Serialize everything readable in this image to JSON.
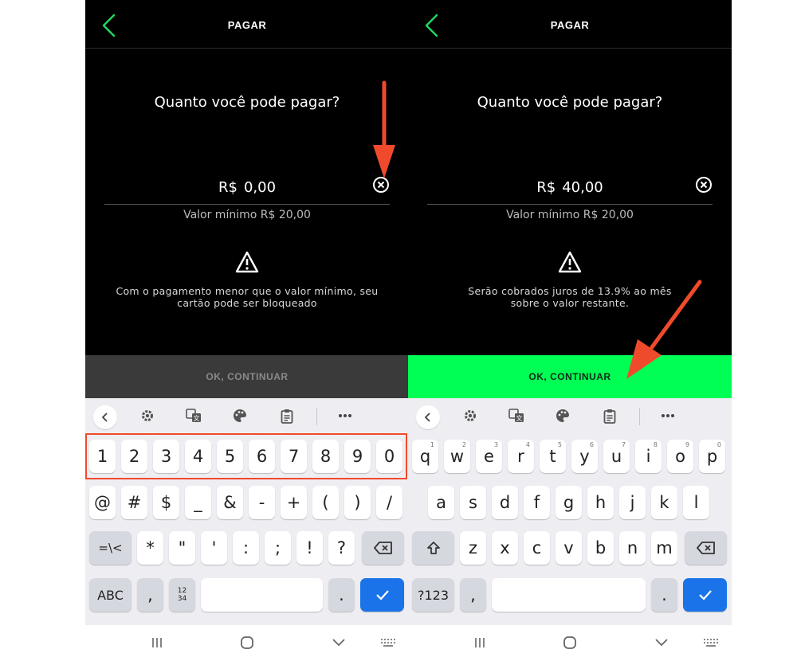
{
  "screens": [
    {
      "id": "left",
      "title": "PAGAR",
      "question": "Quanto você pode pagar?",
      "currency": "R$",
      "amount": "0,00",
      "minimum": "Valor mínimo R$ 20,00",
      "warning_lines": [
        "Com o pagamento menor que o valor mínimo, seu",
        "cartão pode ser bloqueado"
      ],
      "cta_label": "OK, CONTINUAR",
      "cta_state": "disabled"
    },
    {
      "id": "right",
      "title": "PAGAR",
      "question": "Quanto você pode pagar?",
      "currency": "R$",
      "amount": "40,00",
      "minimum": "Valor mínimo R$ 20,00",
      "warning_lines": [
        "Serão cobrados juros de 13.9% ao mês",
        "sobre o valor restante."
      ],
      "cta_label": "OK, CONTINUAR",
      "cta_state": "enabled"
    }
  ],
  "keyboards": {
    "symbols": {
      "row1": [
        "1",
        "2",
        "3",
        "4",
        "5",
        "6",
        "7",
        "8",
        "9",
        "0"
      ],
      "row2": [
        "@",
        "#",
        "$",
        "_",
        "&",
        "-",
        "+",
        "(",
        ")",
        "/"
      ],
      "row3": [
        "*",
        "\"",
        "'",
        ":",
        ";",
        "!",
        "?"
      ],
      "row3_left": "=\\<",
      "row4_left": "ABC",
      "row4_keys": [
        ",",
        "1234"
      ],
      "period": "."
    },
    "letters": {
      "row1": [
        "q",
        "w",
        "e",
        "r",
        "t",
        "y",
        "u",
        "i",
        "o",
        "p"
      ],
      "row1_hints": [
        "1",
        "2",
        "3",
        "4",
        "5",
        "6",
        "7",
        "8",
        "9",
        "0"
      ],
      "row2": [
        "a",
        "s",
        "d",
        "f",
        "g",
        "h",
        "j",
        "k",
        "l"
      ],
      "row3": [
        "z",
        "x",
        "c",
        "v",
        "b",
        "n",
        "m"
      ],
      "row4_left": "?123",
      "row4_keys": [
        ","
      ],
      "period": "."
    }
  },
  "colors": {
    "accent_green": "#00ff55",
    "back_arrow": "#1ed760",
    "annotation": "#f04a2c",
    "enter_blue": "#1a73e8"
  },
  "icons": [
    "chevron-left-icon",
    "clear-circle-icon",
    "warning-triangle-icon",
    "gear-icon",
    "translate-icon",
    "palette-icon",
    "clipboard-icon",
    "more-icon",
    "backspace-icon",
    "shift-icon",
    "check-icon",
    "recent-apps-icon",
    "home-icon",
    "back-nav-icon",
    "keyboard-icon"
  ]
}
